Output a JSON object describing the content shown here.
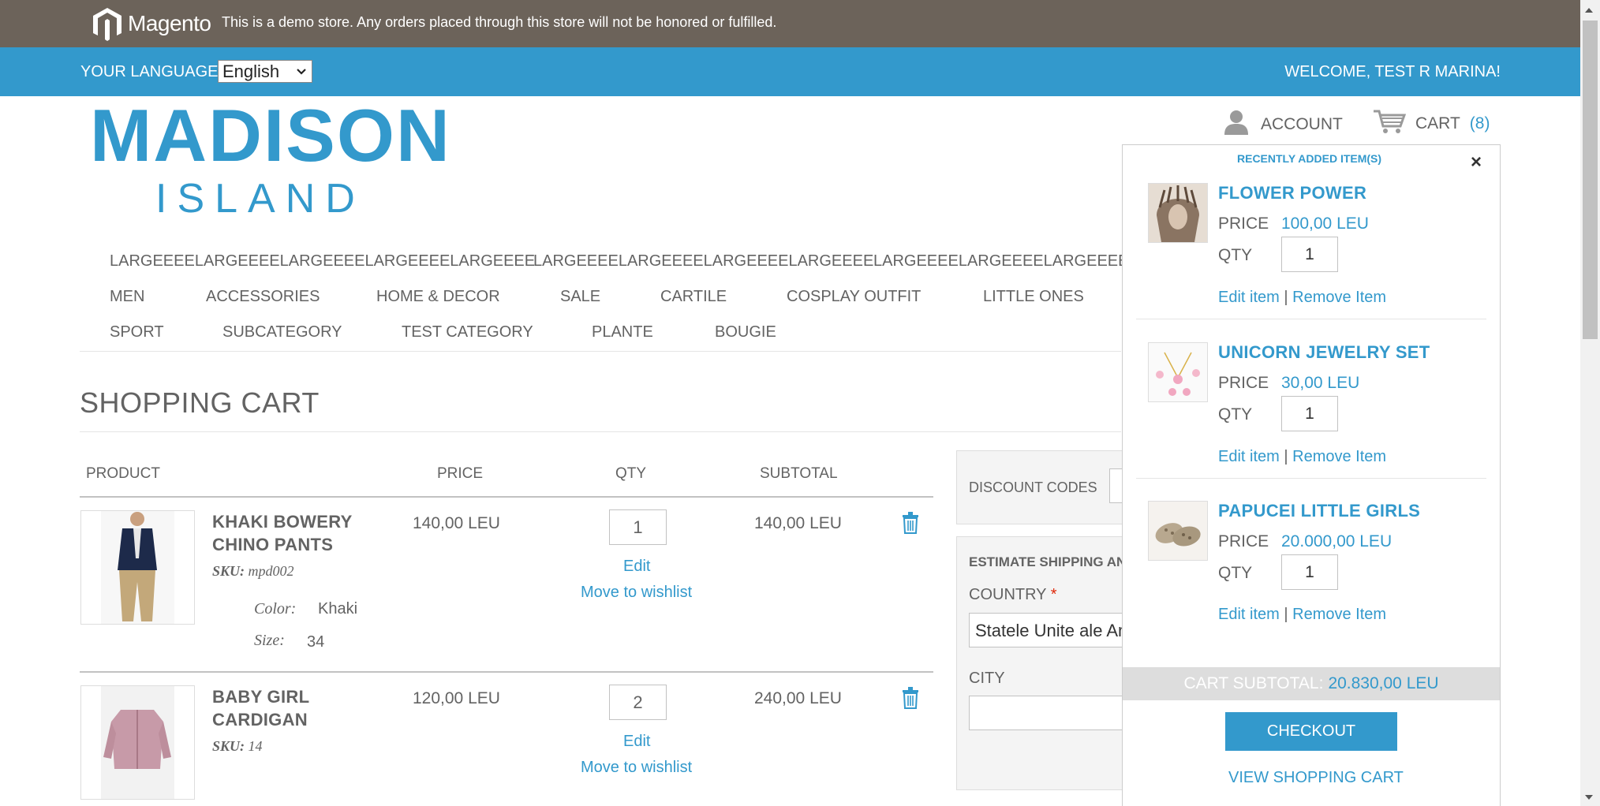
{
  "demo_bar": {
    "brand": "Magento",
    "notice": "This is a demo store. Any orders placed through this store will not be honored or fulfilled."
  },
  "lang_bar": {
    "label": "YOUR LANGUAGE:",
    "selected": "English",
    "welcome": "WELCOME, TEST R MARINA!"
  },
  "logo": {
    "top": "MADISON",
    "bottom": "ISLAND"
  },
  "header": {
    "account_label": "ACCOUNT",
    "cart_label": "CART",
    "cart_count": "(8)"
  },
  "nav": {
    "long_items": [
      "LARGEEEELARGEEEELARGEEEELARGEEEELARGEEEE",
      "LARGEEEELARGEEEELARGEEEELARGEEEE",
      "LARGEEEELARGEEEELARGEEEE"
    ],
    "row1": [
      "MEN",
      "ACCESSORIES",
      "HOME & DECOR",
      "SALE",
      "CARTILE",
      "COSPLAY OUTFIT",
      "LITTLE ONES"
    ],
    "row2": [
      "SPORT",
      "SUBCATEGORY",
      "TEST CATEGORY",
      "PLANTE",
      "BOUGIE"
    ]
  },
  "cart": {
    "title": "SHOPPING CART",
    "headers": {
      "product": "PRODUCT",
      "price": "PRICE",
      "qty": "QTY",
      "subtotal": "SUBTOTAL"
    },
    "items": [
      {
        "name_line1": "KHAKI BOWERY",
        "name_line2": "CHINO PANTS",
        "sku_label": "SKU:",
        "sku": "mpd002",
        "options": [
          {
            "label": "Color:",
            "value": "Khaki"
          },
          {
            "label": "Size:",
            "value": "34"
          }
        ],
        "price": "140,00 LEU",
        "qty": "1",
        "subtotal": "140,00 LEU",
        "edit": "Edit",
        "wishlist": "Move to wishlist"
      },
      {
        "name_line1": "BABY GIRL",
        "name_line2": "CARDIGAN",
        "sku_label": "SKU:",
        "sku": "14",
        "price": "120,00 LEU",
        "qty": "2",
        "subtotal": "240,00 LEU",
        "edit": "Edit",
        "wishlist": "Move to wishlist"
      }
    ]
  },
  "discount": {
    "label": "DISCOUNT CODES"
  },
  "shipping": {
    "title": "ESTIMATE SHIPPING AND TAX",
    "country_label": "COUNTRY",
    "required_mark": "*",
    "country_value": "Statele Unite ale Americii",
    "city_label": "CITY"
  },
  "minicart": {
    "header": "RECENTLY ADDED ITEM(S)",
    "close": "×",
    "price_label": "PRICE",
    "qty_label": "QTY",
    "edit_label": "Edit item",
    "separator": "|",
    "remove_label": "Remove Item",
    "items": [
      {
        "name": "FLOWER POWER",
        "price": "100,00 LEU",
        "qty": "1"
      },
      {
        "name": "UNICORN JEWELRY SET",
        "price": "30,00 LEU",
        "qty": "1"
      },
      {
        "name": "PAPUCEI LITTLE GIRLS",
        "price": "20.000,00 LEU",
        "qty": "1"
      }
    ],
    "subtotal_label": "CART SUBTOTAL:",
    "subtotal_value": "20.830,00 LEU",
    "checkout": "CHECKOUT",
    "view_cart": "VIEW SHOPPING CART"
  },
  "colors": {
    "accent": "#3399cc",
    "demo_bar": "#6c635a",
    "text": "#636363"
  }
}
